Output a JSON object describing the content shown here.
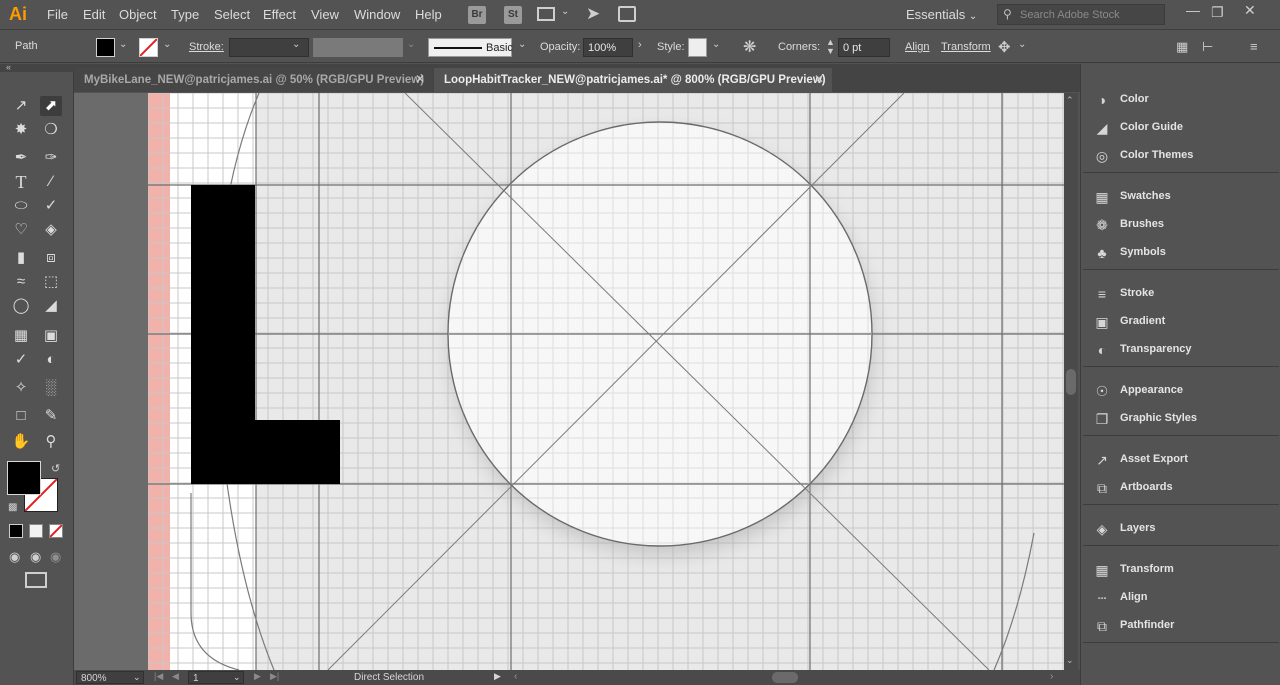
{
  "app": {
    "logo": "Ai"
  },
  "menu": [
    "File",
    "Edit",
    "Object",
    "Type",
    "Select",
    "Effect",
    "View",
    "Window",
    "Help"
  ],
  "header_icons": {
    "bridge": "Br",
    "stock": "St"
  },
  "workspace": {
    "label": "Essentials"
  },
  "search": {
    "placeholder": "Search Adobe Stock"
  },
  "control": {
    "selection_label": "Path",
    "stroke_label": "Stroke:",
    "brush_label": "Basic",
    "opacity_label": "Opacity:",
    "opacity_value": "100%",
    "style_label": "Style:",
    "corners_label": "Corners:",
    "corners_value": "0 pt",
    "align_link": "Align",
    "transform_link": "Transform"
  },
  "tabs": [
    {
      "label": "MyBikeLane_NEW@patricjames.ai @ 50% (RGB/GPU Preview)",
      "active": false
    },
    {
      "label": "LoopHabitTracker_NEW@patricjames.ai* @ 800% (RGB/GPU Preview)",
      "active": true
    }
  ],
  "status": {
    "zoom": "800%",
    "artboard": "1",
    "tool": "Direct Selection"
  },
  "panels": [
    {
      "label": "Color",
      "icon": "palette-icon"
    },
    {
      "label": "Color Guide",
      "icon": "color-guide-icon"
    },
    {
      "label": "Color Themes",
      "icon": "color-themes-icon"
    },
    {
      "label": "Swatches",
      "icon": "swatches-icon"
    },
    {
      "label": "Brushes",
      "icon": "brushes-icon"
    },
    {
      "label": "Symbols",
      "icon": "symbols-icon"
    },
    {
      "label": "Stroke",
      "icon": "stroke-icon"
    },
    {
      "label": "Gradient",
      "icon": "gradient-icon"
    },
    {
      "label": "Transparency",
      "icon": "transparency-icon"
    },
    {
      "label": "Appearance",
      "icon": "appearance-icon"
    },
    {
      "label": "Graphic Styles",
      "icon": "graphic-styles-icon"
    },
    {
      "label": "Asset Export",
      "icon": "asset-export-icon"
    },
    {
      "label": "Artboards",
      "icon": "artboards-icon"
    },
    {
      "label": "Layers",
      "icon": "layers-icon"
    },
    {
      "label": "Transform",
      "icon": "transform-icon"
    },
    {
      "label": "Align",
      "icon": "align-icon"
    },
    {
      "label": "Pathfinder",
      "icon": "pathfinder-icon"
    }
  ],
  "colors": {
    "ui_bg": "#535353",
    "accent_logo": "#ff9a00",
    "fill": "#000000",
    "bleed_guide": "#f2b2ac"
  }
}
